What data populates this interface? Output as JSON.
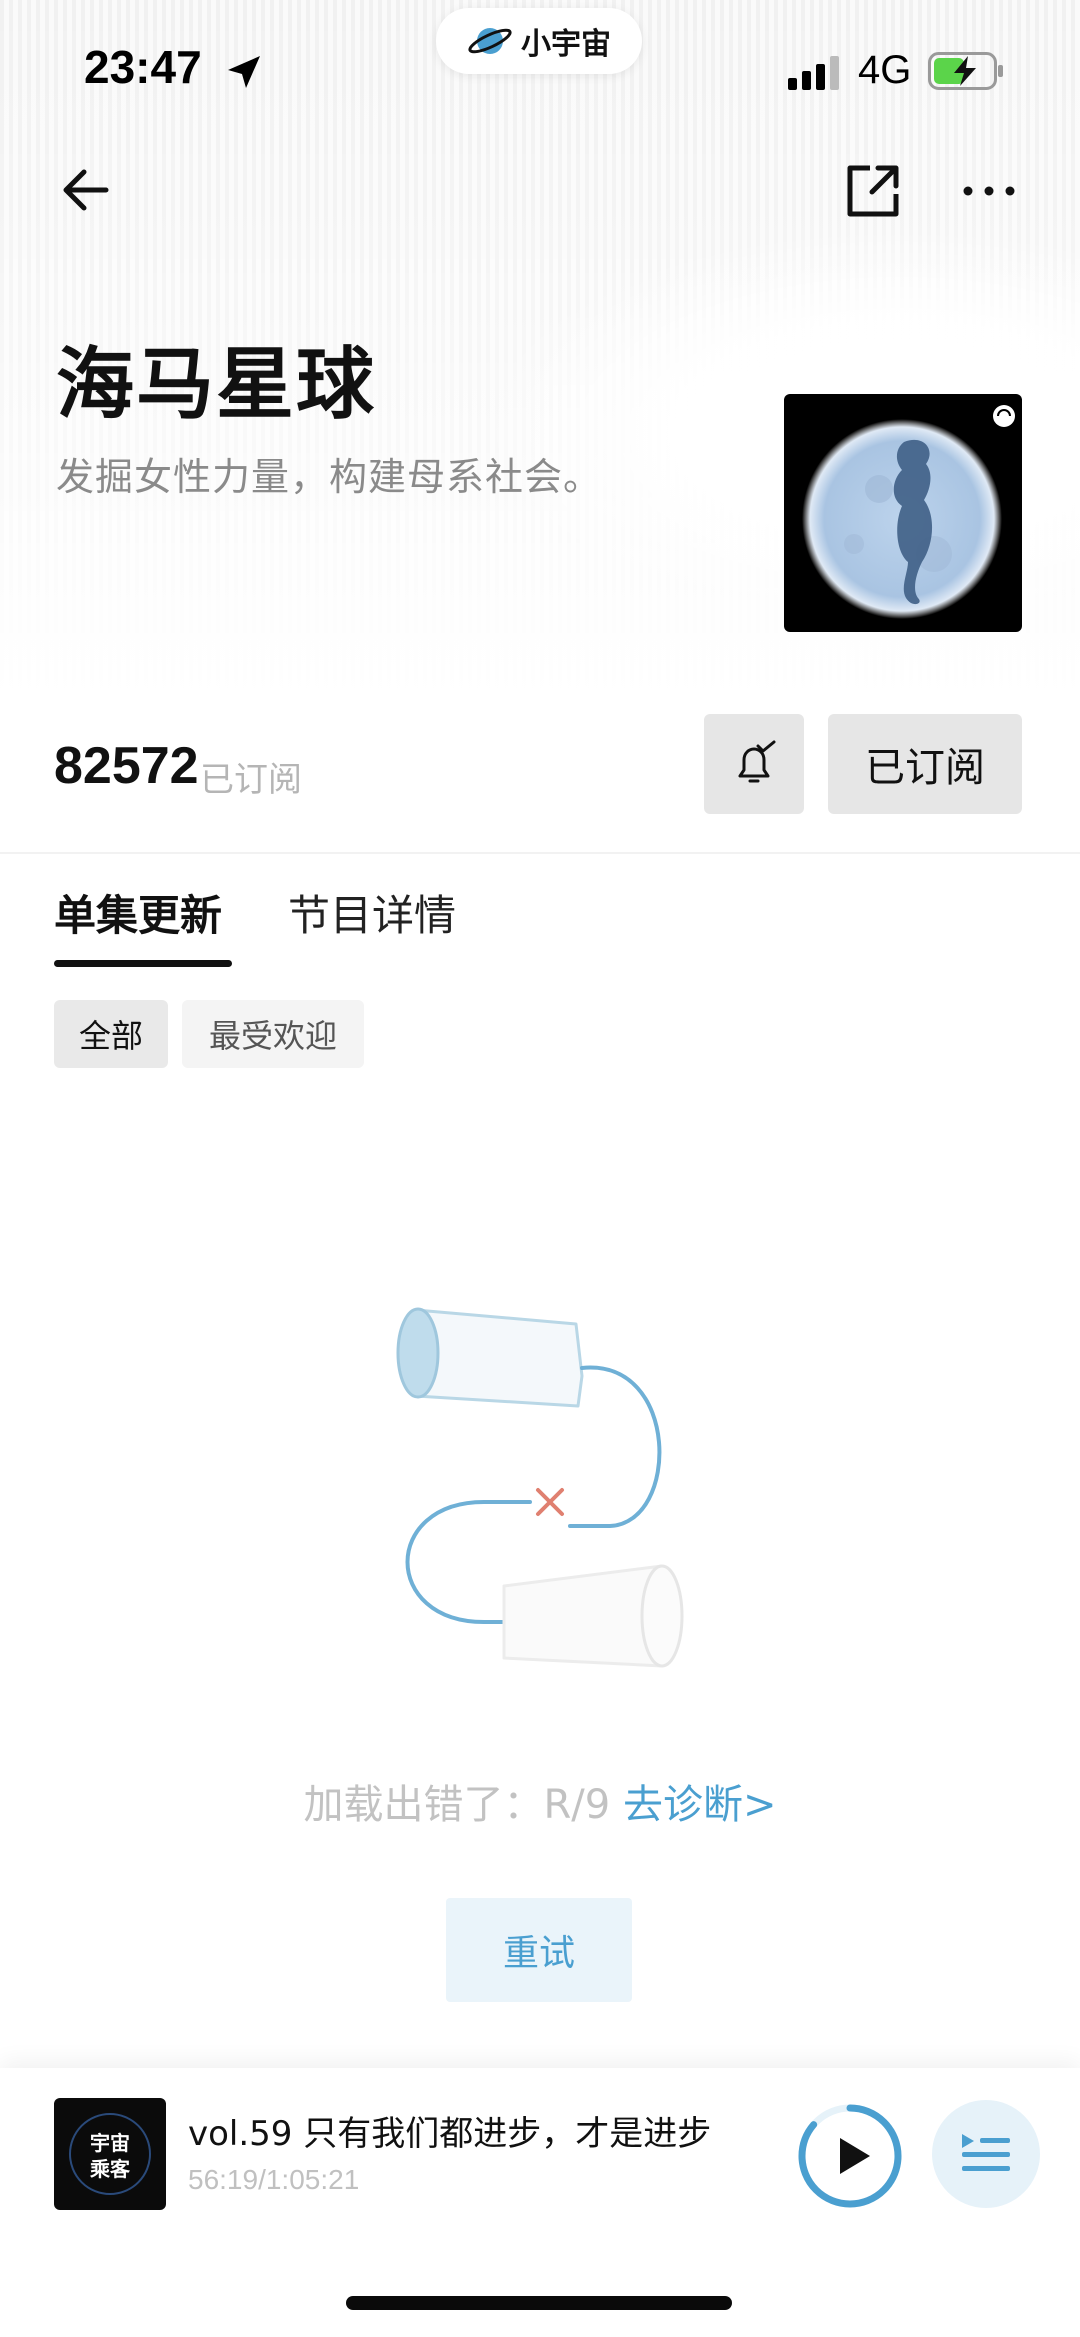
{
  "status_bar": {
    "time": "23:47",
    "network": "4G",
    "app_pill_label": "小宇宙"
  },
  "podcast": {
    "title": "海马星球",
    "subtitle": "发掘女性力量，构建母系社会。",
    "subscriber_count": "82572",
    "subscriber_label": "已订阅",
    "subscribe_button": "已订阅"
  },
  "tabs": [
    {
      "label": "单集更新",
      "active": true
    },
    {
      "label": "节目详情",
      "active": false
    }
  ],
  "filters": [
    {
      "label": "全部",
      "selected": true
    },
    {
      "label": "最受欢迎",
      "selected": false
    }
  ],
  "error": {
    "message": "加载出错了：R/9",
    "diagnose_link": "去诊断>",
    "retry_button": "重试"
  },
  "player": {
    "cover_text_line1": "宇宙",
    "cover_text_line2": "乘客",
    "episode_title": "vol.59 只有我们都进步，才是进步",
    "progress_text": "56:19/1:05:21",
    "progress_fraction": 0.862
  },
  "colors": {
    "accent": "#4a9fd0",
    "battery_fill": "#5bd44a",
    "error_cross": "#e08070"
  },
  "icons": {
    "back": "arrow-left-icon",
    "share": "share-icon",
    "more": "more-icon",
    "bell": "bell-check-icon",
    "play": "play-icon",
    "playlist": "playlist-icon"
  }
}
